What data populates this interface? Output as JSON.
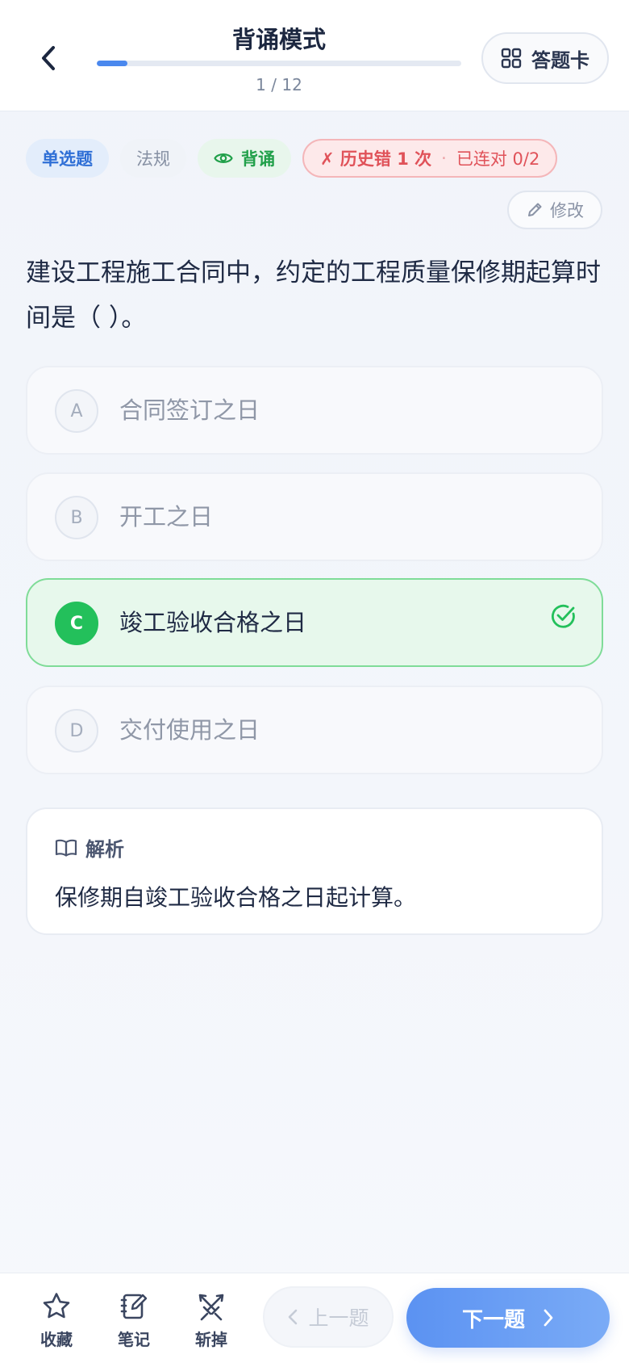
{
  "header": {
    "title": "背诵模式",
    "progress_text": "1 / 12",
    "progress_fraction": 0.0833,
    "answer_card_label": "答题卡"
  },
  "tags": {
    "type": "单选题",
    "category": "法规",
    "mode": "背诵",
    "history_wrong": "✗ 历史错 1 次",
    "separator": "·",
    "streak": "已连对 0/2"
  },
  "edit_label": "修改",
  "question": "建设工程施工合同中，约定的工程质量保修期起算时间是（ ）。",
  "options": [
    {
      "letter": "A",
      "text": "合同签订之日",
      "state": "normal"
    },
    {
      "letter": "B",
      "text": "开工之日",
      "state": "normal"
    },
    {
      "letter": "C",
      "text": "竣工验收合格之日",
      "state": "correct"
    },
    {
      "letter": "D",
      "text": "交付使用之日",
      "state": "normal"
    }
  ],
  "analysis": {
    "title": "解析",
    "body": "保修期自竣工验收合格之日起计算。"
  },
  "bottom": {
    "favorite": "收藏",
    "note": "笔记",
    "eliminate": "斩掉",
    "prev": "上一题",
    "next": "下一题"
  },
  "colors": {
    "accent": "#4a88ee",
    "correct": "#23c05b",
    "error": "#e05259"
  }
}
